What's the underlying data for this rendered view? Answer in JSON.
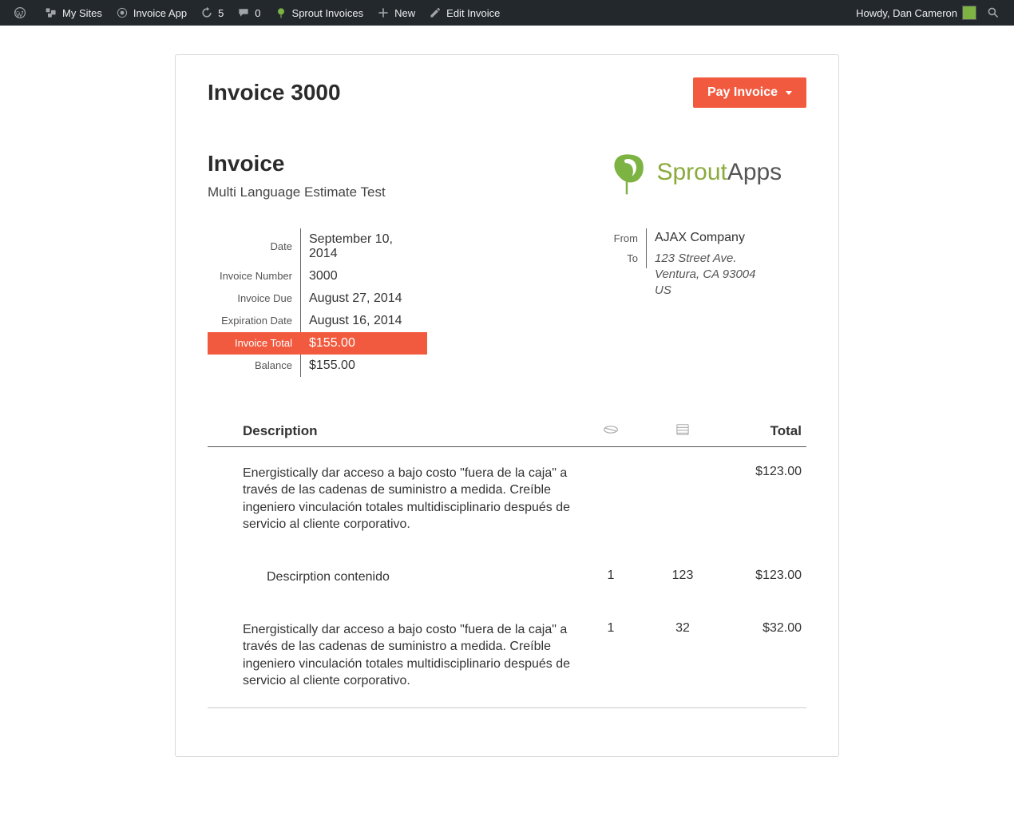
{
  "adminBar": {
    "mySites": "My Sites",
    "siteName": "Invoice App",
    "updatesCount": "5",
    "commentsCount": "0",
    "sproutInvoices": "Sprout Invoices",
    "new": "New",
    "editInvoice": "Edit Invoice",
    "greeting": "Howdy, Dan Cameron"
  },
  "header": {
    "title": "Invoice 3000",
    "payLabel": "Pay Invoice"
  },
  "invoice": {
    "heading": "Invoice",
    "subtitle": "Multi Language Estimate Test",
    "brand": "SproutApps",
    "metaLabels": {
      "date": "Date",
      "number": "Invoice Number",
      "due": "Invoice Due",
      "expiration": "Expiration Date",
      "total": "Invoice Total",
      "balance": "Balance",
      "from": "From",
      "to": "To"
    },
    "meta": {
      "date": "September 10, 2014",
      "number": "3000",
      "due": "August 27, 2014",
      "expiration": "August 16, 2014",
      "total": "$155.00",
      "balance": "$155.00"
    },
    "from": {
      "company": "AJAX Company",
      "street": "123 Street Ave.",
      "cityLine": "Ventura, CA 93004",
      "country": "US"
    }
  },
  "table": {
    "headers": {
      "description": "Description",
      "total": "Total"
    },
    "items": [
      {
        "description": "Energistically dar acceso a bajo costo \"fuera de la caja\" a través de las cadenas de suministro a medida. Creíble ingeniero vinculación totales multidisciplinario después de servicio al cliente corporativo.",
        "qty": "",
        "rate": "",
        "total": "$123.00",
        "indent": false
      },
      {
        "description": "Descirption contenido",
        "qty": "1",
        "rate": "123",
        "total": "$123.00",
        "indent": true
      },
      {
        "description": "Energistically dar acceso a bajo costo \"fuera de la caja\" a través de las cadenas de suministro a medida. Creíble ingeniero vinculación totales multidisciplinario después de servicio al cliente corporativo.",
        "qty": "1",
        "rate": "32",
        "total": "$32.00",
        "indent": false
      }
    ]
  }
}
